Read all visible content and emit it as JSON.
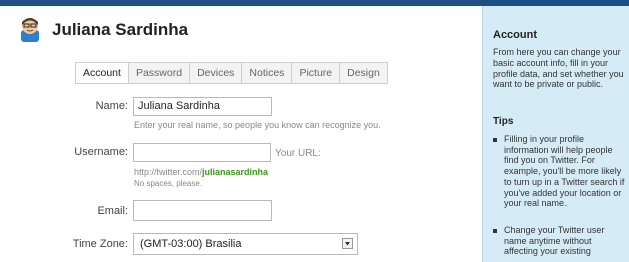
{
  "profile": {
    "name": "Juliana Sardinha"
  },
  "tabs": [
    {
      "label": "Account",
      "active": true
    },
    {
      "label": "Password",
      "active": false
    },
    {
      "label": "Devices",
      "active": false
    },
    {
      "label": "Notices",
      "active": false
    },
    {
      "label": "Picture",
      "active": false
    },
    {
      "label": "Design",
      "active": false
    }
  ],
  "form": {
    "name_label": "Name:",
    "name_value": "Juliana Sardinha",
    "name_hint": "Enter your real name, so people you know can recognize you.",
    "username_label": "Username:",
    "username_value": "",
    "your_url_label": "Your URL:",
    "url_prefix": "http://twitter.com/",
    "url_handle": "julianasardinha",
    "username_hint": "No spaces, please.",
    "email_label": "Email:",
    "email_value": "",
    "timezone_label": "Time Zone:",
    "timezone_value": "(GMT-03:00) Brasilia"
  },
  "sidebar": {
    "title": "Account",
    "description": "From here you can change your basic account info, fill in your profile data, and set whether you want to be private or public.",
    "tips_title": "Tips",
    "tips": [
      "Filling in your profile information will help people find you on Twitter. For example, you'll be more likely to turn up in a Twitter search if you've added your location or your real name.",
      "Change your Twitter user name anytime without affecting your existing"
    ]
  },
  "colors": {
    "accent_bar": "#1d4e85",
    "sidebar_bg": "#d5ecf7",
    "url_handle": "#3c9a12"
  },
  "icons": {
    "avatar": "avatar-icon",
    "select": "chevron-down-icon"
  }
}
